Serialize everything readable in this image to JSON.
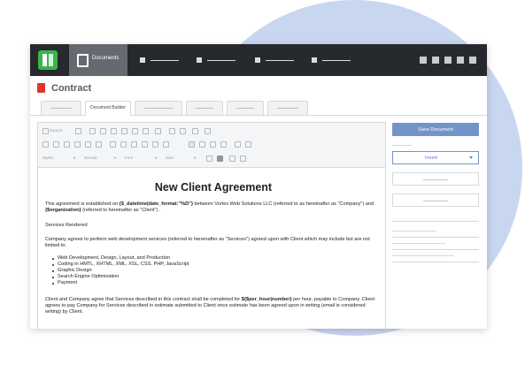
{
  "nav": {
    "active_label": "Documents"
  },
  "header": {
    "title": "Contract",
    "tabs": [
      "",
      "Document Builder",
      "",
      "",
      "",
      ""
    ]
  },
  "toolbar": {
    "source_label": "Source",
    "styles_label": "Styles",
    "format_label": "Normal",
    "font_label": "Font",
    "size_label": "Size"
  },
  "document": {
    "title": "New Client Agreement",
    "para1_a": "This agreement is established on ",
    "para1_token1": "{$_datetime|date_format:\"%D\"}",
    "para1_b": " between Vortex Web Solutions LLC (referred to as hereinafter as \"Company\") and ",
    "para1_token2": "{$organization}",
    "para1_c": " (referred to hereinafter as \"Client\") .",
    "section_heading": "Services Rendered",
    "para2": "Company agrees to perform web development services (referred to hereinafter as \"Services\") agreed upon with Client which may include but are not limited to:",
    "bullets": [
      "Web Development, Design, Layout, and Production",
      "Coding in HMTL, XHTML, XML, XSL, CSS, PHP, JavaScript",
      "Graphic Design",
      "Search Engine Optimization",
      "Payment"
    ],
    "para3_a": "Client and Company agree that Services described in this contract shall be completed for ",
    "para3_token": "${$per_hour|number}",
    "para3_b": " per hour, payable to Company. Client agrees to pay Company for Services described in estimate submitted to Client once estimate has been agreed upon in writing (email is considered writing) by Client."
  },
  "sidebar": {
    "save_label": "Save Document",
    "insert_label": "Insert"
  },
  "colors": {
    "nav_bg": "#262a2e",
    "accent": "#7394c9",
    "brand_green": "#3ab54a",
    "pdf_red": "#d9392b"
  }
}
